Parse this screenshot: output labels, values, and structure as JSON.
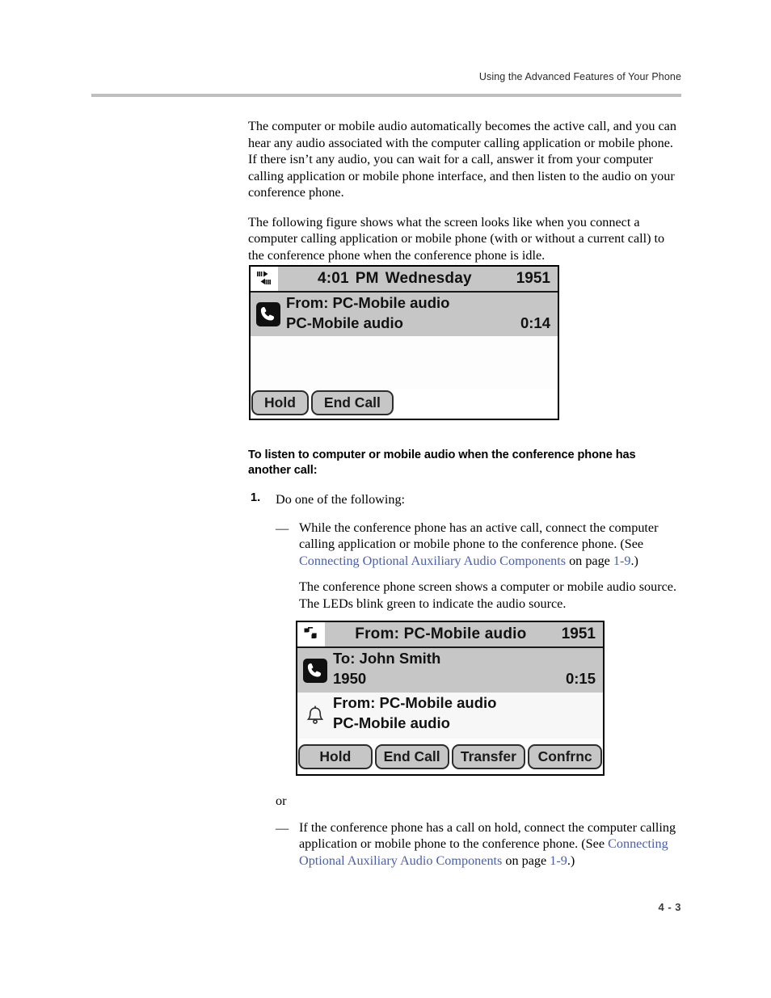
{
  "header": {
    "running_head": "Using the Advanced Features of Your Phone"
  },
  "body": {
    "para1": "The computer or mobile audio automatically becomes the active call, and you can hear any audio associated with the computer calling application or mobile phone. If there isn’t any audio, you can wait for a call, answer it from your computer calling application or mobile phone interface, and then listen to the audio on your conference phone.",
    "para2": "The following figure shows what the screen looks like when you connect a computer calling application or mobile phone (with or without a current call) to the conference phone when the conference phone is idle.",
    "section_heading": "To listen to computer or mobile audio when the conference phone has another call:",
    "step1_marker": "1.",
    "step1_text": "Do one of the following:",
    "dash_marker": "—",
    "bullet1_part1": "While the conference phone has an active call, connect the computer calling application or mobile phone to the conference phone. (See ",
    "bullet1_link": "Connecting Optional Auxiliary Audio Components",
    "bullet1_part2": " on page ",
    "bullet1_pagelink": "1-9",
    "bullet1_part3": ".)",
    "sub_para": "The conference phone screen shows a computer or mobile audio source. The LEDs blink green to indicate the audio source.",
    "or_text": "or",
    "bullet2_part1": "If the conference phone has a call on hold, connect the computer calling application or mobile phone to the conference phone. (See ",
    "bullet2_link": "Connecting Optional Auxiliary Audio Components",
    "bullet2_part2": " on page ",
    "bullet2_pagelink": "1-9",
    "bullet2_part3": ".)"
  },
  "figure1": {
    "status_icon": "audio-transfer-icon",
    "status_time": "4:01",
    "status_ampm": "PM",
    "status_day": "Wednesday",
    "status_extension": "1951",
    "call": {
      "icon": "handset-active-icon",
      "line1": "From: PC-Mobile audio",
      "line2_left": "PC-Mobile audio",
      "line2_right": "0:14"
    },
    "softkeys": [
      "Hold",
      "End Call"
    ]
  },
  "figure2": {
    "status_icon": "music-note-icon",
    "status_title": "From: PC-Mobile audio",
    "status_extension": "1951",
    "call_active": {
      "icon": "handset-active-icon",
      "line1": "To: John Smith",
      "line2_left": "1950",
      "line2_right": "0:15"
    },
    "call_incoming": {
      "icon": "bell-icon",
      "line1": "From: PC-Mobile audio",
      "line2_left": "PC-Mobile audio",
      "line2_right": ""
    },
    "softkeys": [
      "Hold",
      "End Call",
      "Transfer",
      "Confrnc"
    ]
  },
  "footer": {
    "page_number": "4 - 3"
  },
  "colors": {
    "link": "#4a5fa8",
    "lcd_gray": "#c6c6c6",
    "rule": "#bfbfbf"
  }
}
